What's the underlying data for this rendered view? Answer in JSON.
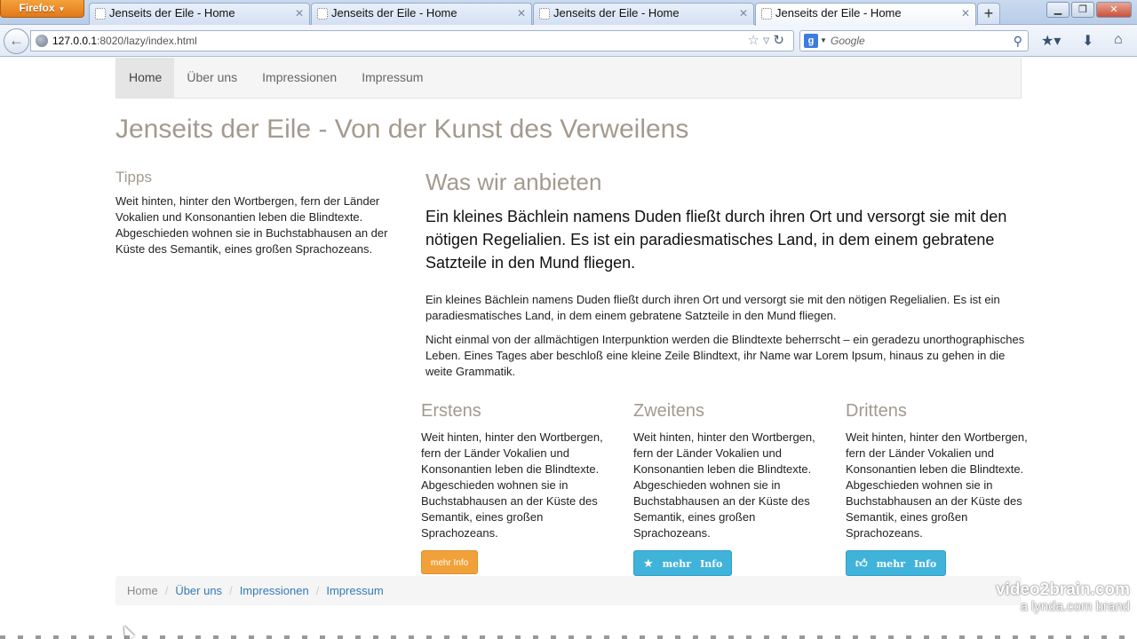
{
  "browser": {
    "menu_button": "Firefox",
    "tabs": [
      {
        "title": "Jenseits der Eile - Home"
      },
      {
        "title": "Jenseits der Eile - Home"
      },
      {
        "title": "Jenseits der Eile - Home"
      },
      {
        "title": "Jenseits der Eile - Home"
      }
    ],
    "new_tab": "+",
    "url_host": "127.0.0.1",
    "url_path": ":8020/lazy/index.html",
    "search_placeholder": "Google",
    "search_engine_letter": "g"
  },
  "site": {
    "nav": [
      "Home",
      "Über uns",
      "Impressionen",
      "Impressum"
    ],
    "title": "Jenseits der Eile - Von der Kunst des Verweilens",
    "sidebar": {
      "heading": "Tipps",
      "text": "Weit hinten, hinter den Wortbergen, fern der Länder Vokalien und Konsonantien leben die Blindtexte. Abgeschieden wohnen sie in Buchstabhausen an der Küste des Semantik, eines großen Sprachozeans."
    },
    "main": {
      "heading": "Was wir anbieten",
      "lead": "Ein kleines Bächlein namens Duden fließt durch ihren Ort und versorgt sie mit den nötigen Regelialien. Es ist ein paradiesmatisches Land, in dem einem gebratene Satzteile in den Mund fliegen.",
      "para1": "Ein kleines Bächlein namens Duden fließt durch ihren Ort und versorgt sie mit den nötigen Regelialien. Es ist ein paradiesmatisches Land, in dem einem gebratene Satzteile in den Mund fliegen.",
      "para2": "Nicht einmal von der allmächtigen Interpunktion werden die Blindtexte beherrscht – ein geradezu unorthographisches Leben. Eines Tages aber beschloß eine kleine Zeile Blindtext, ihr Name war Lorem Ipsum, hinaus zu gehen in die weite Grammatik."
    },
    "columns": [
      {
        "heading": "Erstens",
        "text": "Weit hinten, hinter den Wortbergen, fern der Länder Vokalien und Konsonantien leben die Blindtexte. Abgeschieden wohnen sie in Buchstabhausen an der Küste des Semantik, eines großen Sprachozeans.",
        "button": "mehr Info"
      },
      {
        "heading": "Zweitens",
        "text": "Weit hinten, hinter den Wortbergen, fern der Länder Vokalien und Konsonantien leben die Blindtexte. Abgeschieden wohnen sie in Buchstabhausen an der Küste des Semantik, eines großen Sprachozeans.",
        "button_word1": "mehr",
        "button_word2": "Info",
        "button_icon": "star-icon"
      },
      {
        "heading": "Drittens",
        "text": "Weit hinten, hinter den Wortbergen, fern der Länder Vokalien und Konsonantien leben die Blindtexte. Abgeschieden wohnen sie in Buchstabhausen an der Küste des Semantik, eines großen Sprachozeans.",
        "button_word1": "mehr",
        "button_word2": "Info",
        "button_icon": "thumbs-up-icon"
      }
    ],
    "breadcrumb": [
      "Home",
      "Über uns",
      "Impressionen",
      "Impressum"
    ],
    "breadcrumb_separator": "/"
  },
  "watermark": {
    "line1": "video2brain.com",
    "line2": "a lynda.com brand"
  },
  "colors": {
    "heading": "#a39a8e",
    "link": "#337ab7",
    "button_orange": "#f0a13a",
    "button_blue": "#40b3db",
    "firefox_button": "#e2791a"
  }
}
